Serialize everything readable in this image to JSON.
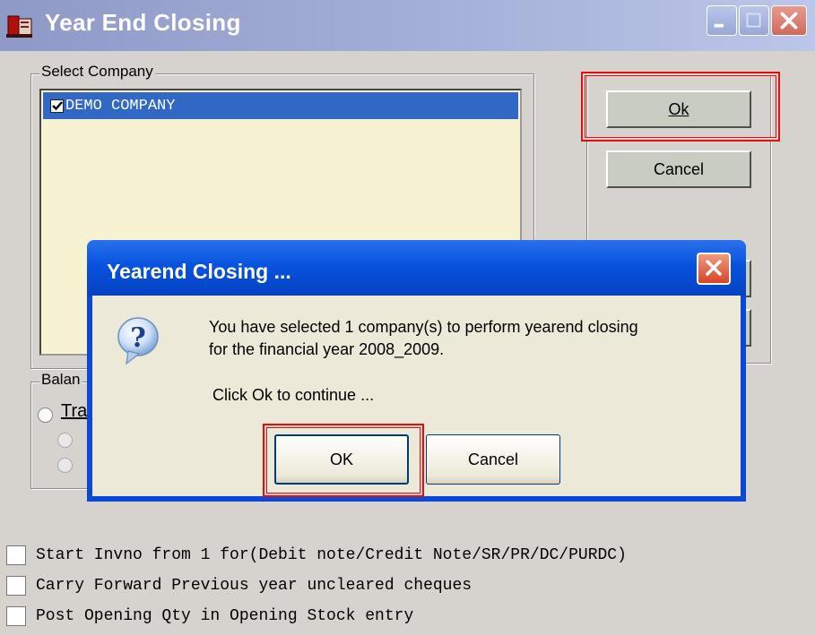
{
  "window": {
    "title": "Year End Closing",
    "controls": {
      "minimize": "minimize",
      "maximize": "maximize",
      "close": "close"
    }
  },
  "select_company": {
    "group_label": "Select Company",
    "companies": [
      {
        "name": "DEMO COMPANY",
        "checked": true
      }
    ]
  },
  "buttons": {
    "ok": "Ok",
    "cancel": "Cancel"
  },
  "balance_group": {
    "label_partial": "Balan",
    "option_partial": "Tra"
  },
  "options": [
    {
      "label": "Start Invno from 1 for(Debit note/Credit Note/SR/PR/DC/PURDC)",
      "checked": false
    },
    {
      "label": "Carry Forward Previous year uncleared cheques",
      "checked": false
    },
    {
      "label": "Post Opening Qty in Opening Stock entry",
      "checked": false
    }
  ],
  "dialog": {
    "title": "Yearend Closing ...",
    "message_line1": "You have selected 1 company(s) to perform yearend closing",
    "message_line2": "for the financial year 2008_2009.",
    "prompt": "Click Ok to continue ...",
    "ok_label": "OK",
    "cancel_label": "Cancel",
    "icon": "question-icon"
  },
  "colors": {
    "highlight": "#e01010",
    "selection": "#3168c6",
    "dialog_title": "#0753de"
  }
}
